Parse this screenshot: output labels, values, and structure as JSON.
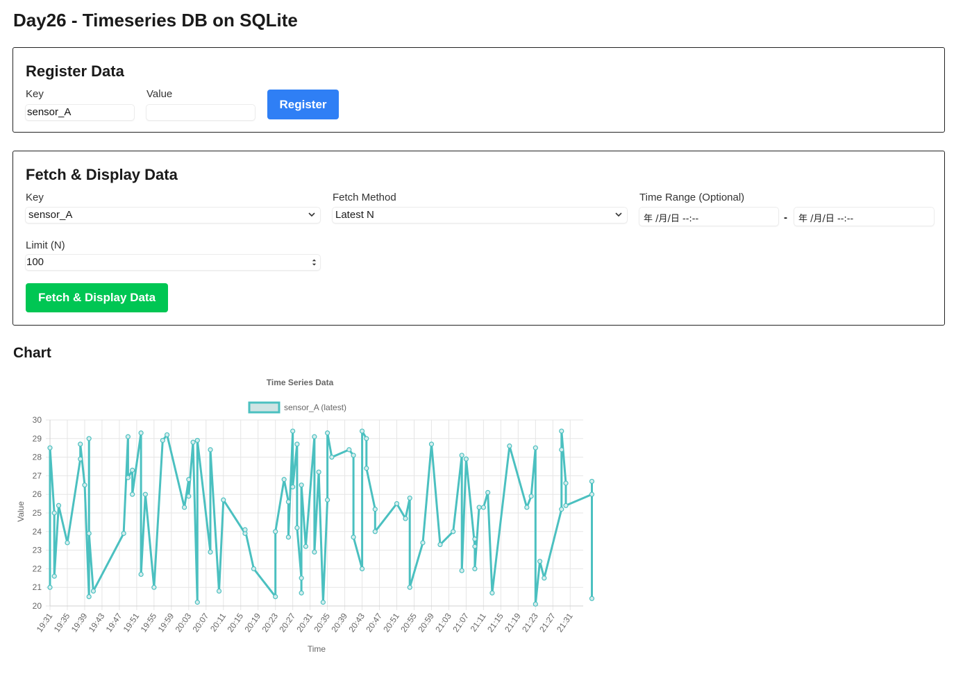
{
  "page": {
    "title": "Day26 - Timeseries DB on SQLite"
  },
  "register": {
    "heading": "Register Data",
    "key_label": "Key",
    "key_value": "sensor_A",
    "value_label": "Value",
    "value_value": "",
    "button_label": "Register",
    "button_color": "#2f7ff5"
  },
  "fetch": {
    "heading": "Fetch & Display Data",
    "key_label": "Key",
    "key_selected": "sensor_A",
    "method_label": "Fetch Method",
    "method_selected": "Latest N",
    "range_label": "Time Range (Optional)",
    "range_start_placeholder": "年 /月/日 --:--",
    "range_separator": "-",
    "range_end_placeholder": "年 /月/日 --:--",
    "limit_label": "Limit (N)",
    "limit_value": "100",
    "button_label": "Fetch & Display Data",
    "button_color": "#00c653"
  },
  "chart_section": {
    "heading": "Chart"
  },
  "chart_data": {
    "type": "line",
    "title": "Time Series Data",
    "xlabel": "Time",
    "ylabel": "Value",
    "ylim": [
      20,
      30
    ],
    "yticks": [
      20,
      21,
      22,
      23,
      24,
      25,
      26,
      27,
      28,
      29,
      30
    ],
    "x_ticks": [
      "19:31",
      "19:35",
      "19:39",
      "19:43",
      "19:47",
      "19:51",
      "19:55",
      "19:59",
      "20:03",
      "20:07",
      "20:11",
      "20:15",
      "20:19",
      "20:23",
      "20:27",
      "20:31",
      "20:35",
      "20:39",
      "20:43",
      "20:47",
      "20:51",
      "20:55",
      "20:59",
      "21:03",
      "21:07",
      "21:11",
      "21:15",
      "21:19",
      "21:23",
      "21:27",
      "21:31"
    ],
    "x_range_minutes": [
      1171,
      1294
    ],
    "grid": true,
    "legend_position": "top",
    "color": "#4bc0c0",
    "series": [
      {
        "name": "sensor_A (latest)",
        "points": [
          [
            "19:31",
            21.0
          ],
          [
            "19:31",
            28.5
          ],
          [
            "19:32",
            25.0
          ],
          [
            "19:32",
            21.6
          ],
          [
            "19:33",
            25.4
          ],
          [
            "19:35",
            23.4
          ],
          [
            "19:38",
            27.9
          ],
          [
            "19:38",
            28.7
          ],
          [
            "19:39",
            26.5
          ],
          [
            "19:40",
            20.5
          ],
          [
            "19:40",
            29.0
          ],
          [
            "19:40",
            23.9
          ],
          [
            "19:41",
            20.8
          ],
          [
            "19:48",
            23.9
          ],
          [
            "19:49",
            29.1
          ],
          [
            "19:49",
            26.9
          ],
          [
            "19:50",
            27.3
          ],
          [
            "19:50",
            26.0
          ],
          [
            "19:52",
            29.3
          ],
          [
            "19:52",
            21.7
          ],
          [
            "19:53",
            26.0
          ],
          [
            "19:55",
            21.0
          ],
          [
            "19:57",
            28.9
          ],
          [
            "19:58",
            29.2
          ],
          [
            "20:02",
            25.3
          ],
          [
            "20:03",
            26.8
          ],
          [
            "20:03",
            25.9
          ],
          [
            "20:04",
            28.8
          ],
          [
            "20:05",
            20.2
          ],
          [
            "20:05",
            28.9
          ],
          [
            "20:08",
            22.9
          ],
          [
            "20:08",
            28.4
          ],
          [
            "20:10",
            20.8
          ],
          [
            "20:11",
            25.7
          ],
          [
            "20:16",
            23.9
          ],
          [
            "20:16",
            24.1
          ],
          [
            "20:18",
            22.0
          ],
          [
            "20:23",
            20.5
          ],
          [
            "20:23",
            24.0
          ],
          [
            "20:25",
            26.8
          ],
          [
            "20:26",
            25.6
          ],
          [
            "20:26",
            23.7
          ],
          [
            "20:27",
            29.4
          ],
          [
            "20:27",
            26.4
          ],
          [
            "20:28",
            28.7
          ],
          [
            "20:28",
            24.2
          ],
          [
            "20:29",
            21.5
          ],
          [
            "20:29",
            20.7
          ],
          [
            "20:29",
            26.5
          ],
          [
            "20:30",
            23.2
          ],
          [
            "20:32",
            29.1
          ],
          [
            "20:32",
            22.9
          ],
          [
            "20:33",
            27.2
          ],
          [
            "20:34",
            20.2
          ],
          [
            "20:35",
            25.7
          ],
          [
            "20:35",
            29.3
          ],
          [
            "20:36",
            28.0
          ],
          [
            "20:40",
            28.4
          ],
          [
            "20:41",
            28.1
          ],
          [
            "20:41",
            23.7
          ],
          [
            "20:43",
            22.0
          ],
          [
            "20:43",
            29.4
          ],
          [
            "20:44",
            29.0
          ],
          [
            "20:44",
            27.4
          ],
          [
            "20:46",
            25.2
          ],
          [
            "20:46",
            24.0
          ],
          [
            "20:51",
            25.5
          ],
          [
            "20:53",
            24.7
          ],
          [
            "20:54",
            25.8
          ],
          [
            "20:54",
            21.0
          ],
          [
            "20:57",
            23.4
          ],
          [
            "20:59",
            28.7
          ],
          [
            "21:01",
            23.3
          ],
          [
            "21:04",
            24.0
          ],
          [
            "21:06",
            28.1
          ],
          [
            "21:06",
            21.9
          ],
          [
            "21:07",
            27.9
          ],
          [
            "21:09",
            23.2
          ],
          [
            "21:09",
            23.6
          ],
          [
            "21:09",
            22.0
          ],
          [
            "21:10",
            25.3
          ],
          [
            "21:11",
            25.3
          ],
          [
            "21:12",
            26.1
          ],
          [
            "21:13",
            20.7
          ],
          [
            "21:17",
            28.6
          ],
          [
            "21:21",
            25.3
          ],
          [
            "21:22",
            25.9
          ],
          [
            "21:23",
            28.5
          ],
          [
            "21:23",
            20.1
          ],
          [
            "21:24",
            22.4
          ],
          [
            "21:25",
            21.5
          ],
          [
            "21:29",
            25.2
          ],
          [
            "21:29",
            28.4
          ],
          [
            "21:29",
            29.4
          ],
          [
            "21:30",
            26.6
          ],
          [
            "21:30",
            25.4
          ],
          [
            "21:36",
            26.0
          ],
          [
            "21:36",
            26.7
          ],
          [
            "21:36",
            20.4
          ]
        ]
      }
    ]
  }
}
